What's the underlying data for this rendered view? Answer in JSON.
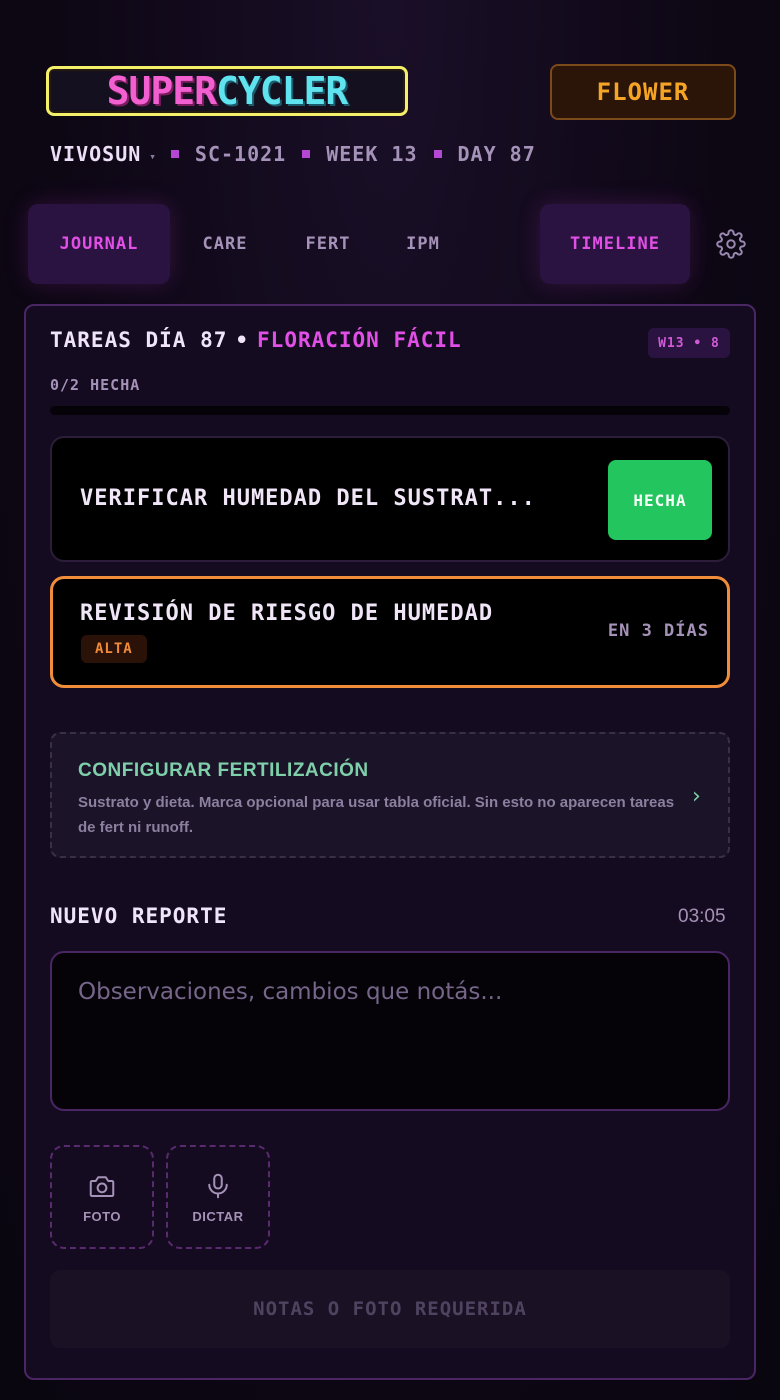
{
  "header": {
    "logo_part1": "SUPER",
    "logo_part2": "CYCLER",
    "phase_button": "FLOWER",
    "tent": "VIVOSUN",
    "tent_caret": "▾",
    "plant_id": "SC-1021",
    "week": "WEEK 13",
    "day": "DAY 87"
  },
  "tabs": [
    {
      "label": "JOURNAL",
      "active": true
    },
    {
      "label": "CARE",
      "active": false
    },
    {
      "label": "FERT",
      "active": false
    },
    {
      "label": "IPM",
      "active": false
    },
    {
      "label": "TIMELINE",
      "active": true
    }
  ],
  "tasks_section": {
    "title": "TAREAS DÍA 87",
    "separator": "•",
    "phase_label": "FLORACIÓN FÁCIL",
    "week_badge": "W13 • 8",
    "progress_text": "0/2 HECHA",
    "progress_fraction": 0
  },
  "tasks": [
    {
      "label": "VERIFICAR HUMEDAD DEL SUSTRAT...",
      "action": "HECHA"
    },
    {
      "label": "REVISIÓN DE RIESGO DE HUMEDAD",
      "priority": "ALTA",
      "due": "EN 3 DÍAS"
    }
  ],
  "fert_card": {
    "title": "CONFIGURAR FERTILIZACIÓN",
    "description": "Sustrato y dieta. Marca opcional para usar tabla oficial. Sin esto no aparecen tareas de fert ni runoff.",
    "chevron": "›"
  },
  "report": {
    "title": "NUEVO REPORTE",
    "time": "03:05",
    "placeholder": "Observaciones, cambios que notás...",
    "photo_label": "FOTO",
    "dictate_label": "DICTAR",
    "submit_label": "NOTAS O FOTO REQUERIDA"
  },
  "colors": {
    "accent": "#e14fe6",
    "phase": "#f5a425",
    "done": "#22c55e",
    "priority_high": "#ef8d3a"
  }
}
